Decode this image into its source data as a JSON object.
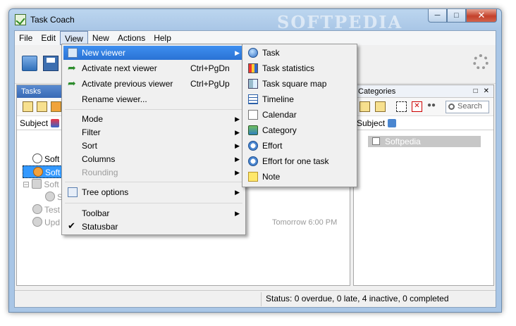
{
  "window": {
    "title": "Task Coach",
    "watermark": "SOFTPEDIA"
  },
  "menubar": {
    "items": [
      "File",
      "Edit",
      "View",
      "New",
      "Actions",
      "Help"
    ]
  },
  "tasks_panel": {
    "title": "Tasks",
    "column": "Subject",
    "rows": [
      {
        "label": "Soft",
        "state": "normal"
      },
      {
        "label": "Soft",
        "state": "selected"
      },
      {
        "label": "Soft",
        "state": "grayed"
      },
      {
        "label": "S",
        "state": "grayed"
      },
      {
        "label": "Test",
        "state": "grayed"
      },
      {
        "label": "Upd",
        "state": "grayed"
      }
    ],
    "due": "Tomorrow 6:00 PM"
  },
  "categories_panel": {
    "title": "Categories",
    "column": "Subject",
    "search_placeholder": "Search",
    "rows": [
      "Softpedia"
    ]
  },
  "view_menu": {
    "items": [
      {
        "label": "New viewer",
        "shortcut": "",
        "submenu": true,
        "highlight": true
      },
      {
        "label": "Activate next viewer",
        "shortcut": "Ctrl+PgDn"
      },
      {
        "label": "Activate previous viewer",
        "shortcut": "Ctrl+PgUp"
      },
      {
        "label": "Rename viewer..."
      },
      {
        "label": "Mode",
        "submenu": true
      },
      {
        "label": "Filter",
        "submenu": true
      },
      {
        "label": "Sort",
        "submenu": true
      },
      {
        "label": "Columns",
        "submenu": true
      },
      {
        "label": "Rounding",
        "submenu": true,
        "disabled": true
      },
      {
        "label": "Tree options",
        "submenu": true
      },
      {
        "label": "Toolbar",
        "submenu": true
      },
      {
        "label": "Statusbar",
        "checked": true
      }
    ]
  },
  "new_viewer_submenu": {
    "items": [
      "Task",
      "Task statistics",
      "Task square map",
      "Timeline",
      "Calendar",
      "Category",
      "Effort",
      "Effort for one task",
      "Note"
    ]
  },
  "statusbar": {
    "text": "Status: 0 overdue, 0 late, 4 inactive, 0 completed"
  }
}
